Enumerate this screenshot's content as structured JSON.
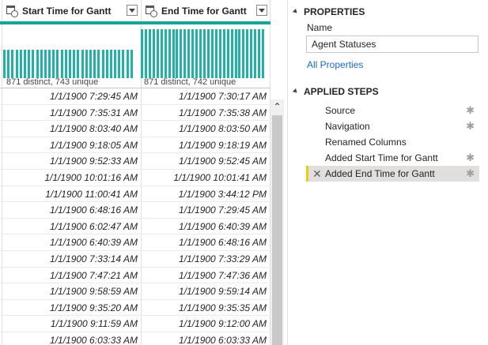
{
  "grid": {
    "columns": [
      {
        "name": "Start Time for Gantt",
        "stats": "871 distinct, 743 unique"
      },
      {
        "name": "End Time for Gantt",
        "stats": "871 distinct, 742 unique"
      }
    ],
    "rows": [
      [
        "1/1/1900 7:29:45 AM",
        "1/1/1900 7:30:17 AM"
      ],
      [
        "1/1/1900 7:35:31 AM",
        "1/1/1900 7:35:38 AM"
      ],
      [
        "1/1/1900 8:03:40 AM",
        "1/1/1900 8:03:50 AM"
      ],
      [
        "1/1/1900 9:18:05 AM",
        "1/1/1900 9:18:19 AM"
      ],
      [
        "1/1/1900 9:52:33 AM",
        "1/1/1900 9:52:45 AM"
      ],
      [
        "1/1/1900 10:01:16 AM",
        "1/1/1900 10:01:41 AM"
      ],
      [
        "1/1/1900 11:00:41 AM",
        "1/1/1900 3:44:12 PM"
      ],
      [
        "1/1/1900 6:48:16 AM",
        "1/1/1900 7:29:45 AM"
      ],
      [
        "1/1/1900 6:02:47 AM",
        "1/1/1900 6:40:39 AM"
      ],
      [
        "1/1/1900 6:40:39 AM",
        "1/1/1900 6:48:16 AM"
      ],
      [
        "1/1/1900 7:33:14 AM",
        "1/1/1900 7:33:29 AM"
      ],
      [
        "1/1/1900 7:47:21 AM",
        "1/1/1900 7:47:36 AM"
      ],
      [
        "1/1/1900 9:58:59 AM",
        "1/1/1900 9:59:14 AM"
      ],
      [
        "1/1/1900 9:35:20 AM",
        "1/1/1900 9:35:35 AM"
      ],
      [
        "1/1/1900 9:11:59 AM",
        "1/1/1900 9:12:00 AM"
      ],
      [
        "1/1/1900 6:03:33 AM",
        "1/1/1900 6:03:33 AM"
      ]
    ],
    "histograms": [
      [
        0.58,
        0.58,
        0.58,
        0.58,
        0.58,
        0.58,
        0.58,
        0.58,
        0.58,
        0.58,
        0.58,
        0.58,
        0.58,
        0.58,
        0.58,
        0.58,
        0.58,
        0.58,
        0.58,
        0.58,
        0.58,
        0.58,
        0.58,
        0.58,
        0.58,
        0.58,
        0.58,
        0.58,
        0.58,
        0.58,
        0.58,
        0.58
      ],
      [
        1,
        1,
        1,
        1,
        1,
        1,
        1,
        1,
        1,
        1,
        1,
        1,
        1,
        1,
        1,
        1,
        1,
        1,
        1,
        1,
        1,
        1,
        1,
        1,
        1,
        1,
        1,
        1,
        1,
        1,
        1,
        1
      ]
    ]
  },
  "properties": {
    "title": "PROPERTIES",
    "name_label": "Name",
    "name_value": "Agent Statuses",
    "all_properties": "All Properties"
  },
  "applied_steps": {
    "title": "APPLIED STEPS",
    "steps": [
      {
        "label": "Source",
        "has_gear": true,
        "selected": false
      },
      {
        "label": "Navigation",
        "has_gear": true,
        "selected": false
      },
      {
        "label": "Renamed Columns",
        "has_gear": false,
        "selected": false
      },
      {
        "label": "Added Start Time for Gantt",
        "has_gear": true,
        "selected": false
      },
      {
        "label": "Added End Time for Gantt",
        "has_gear": true,
        "selected": true
      }
    ]
  },
  "colors": {
    "quality_bar": "#14a49a",
    "histogram_bar": "#20b2a5",
    "link": "#1b6ac9",
    "selected_step_accent": "#f2c811"
  },
  "icons": {
    "column_type": "calendar-clock-icon",
    "step_settings": "gear-icon",
    "step_delete": "close-icon",
    "collapse": "chevron-down-icon"
  }
}
